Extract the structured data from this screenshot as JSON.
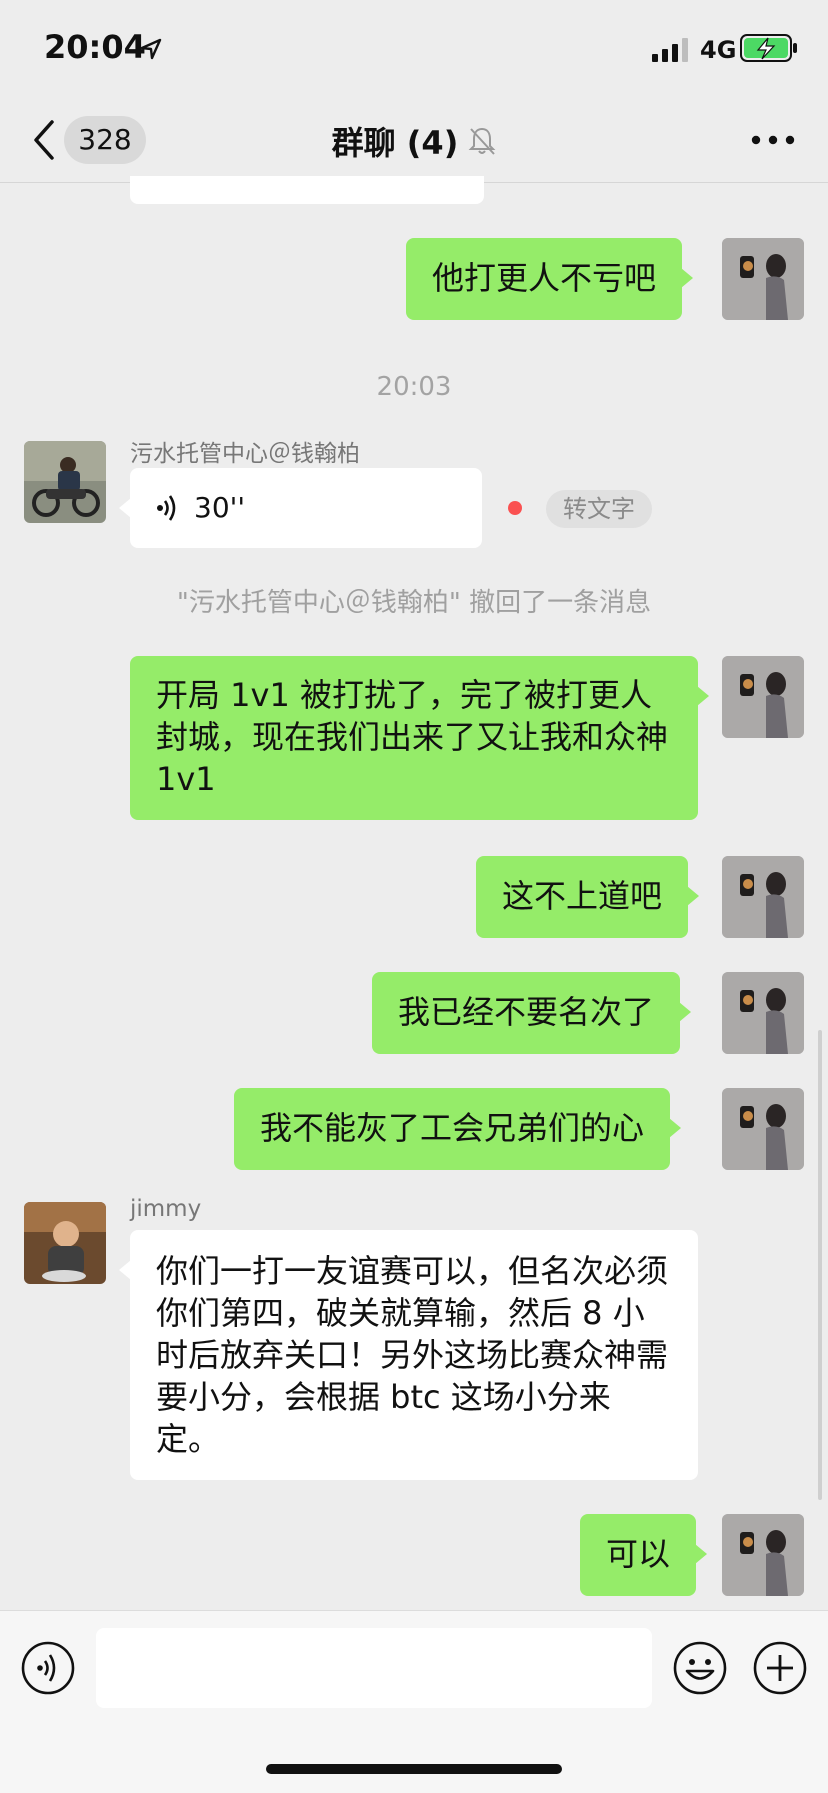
{
  "status_bar": {
    "time": "20:04",
    "network": "4G"
  },
  "nav": {
    "back_count": "328",
    "title": "群聊 (4)"
  },
  "messages": {
    "m1": "他打更人不亏吧",
    "time_divider": "20:03",
    "voice_sender": "污水托管中心＠钱翰柏",
    "voice_duration": "30''",
    "voice_convert": "转文字",
    "recall_notice": "\"污水托管中心＠钱翰柏\" 撤回了一条消息",
    "m2": "开局 1v1 被打扰了，完了被打更人封城，现在我们出来了又让我和众神 1v1",
    "m3": "这不上道吧",
    "m4": "我已经不要名次了",
    "m5": "我不能灰了工会兄弟们的心",
    "jimmy_sender": "jimmy",
    "jimmy_msg": "你们一打一友谊赛可以，但名次必须你们第四，破关就算输，然后 8 小时后放弃关口！另外这场比赛众神需要小分，会根据 btc 这场小分来定。",
    "m6": "可以"
  },
  "icons": {
    "back": "chevron-left-icon",
    "mute": "bell-slash-icon",
    "more": "more-dots-icon",
    "voice": "voice-wave-icon",
    "emoji": "smiley-icon",
    "add": "plus-icon"
  },
  "colors": {
    "bubble_self": "#95ec69",
    "bubble_other": "#ffffff",
    "background": "#ededed",
    "unread_dot": "#fa5151"
  }
}
